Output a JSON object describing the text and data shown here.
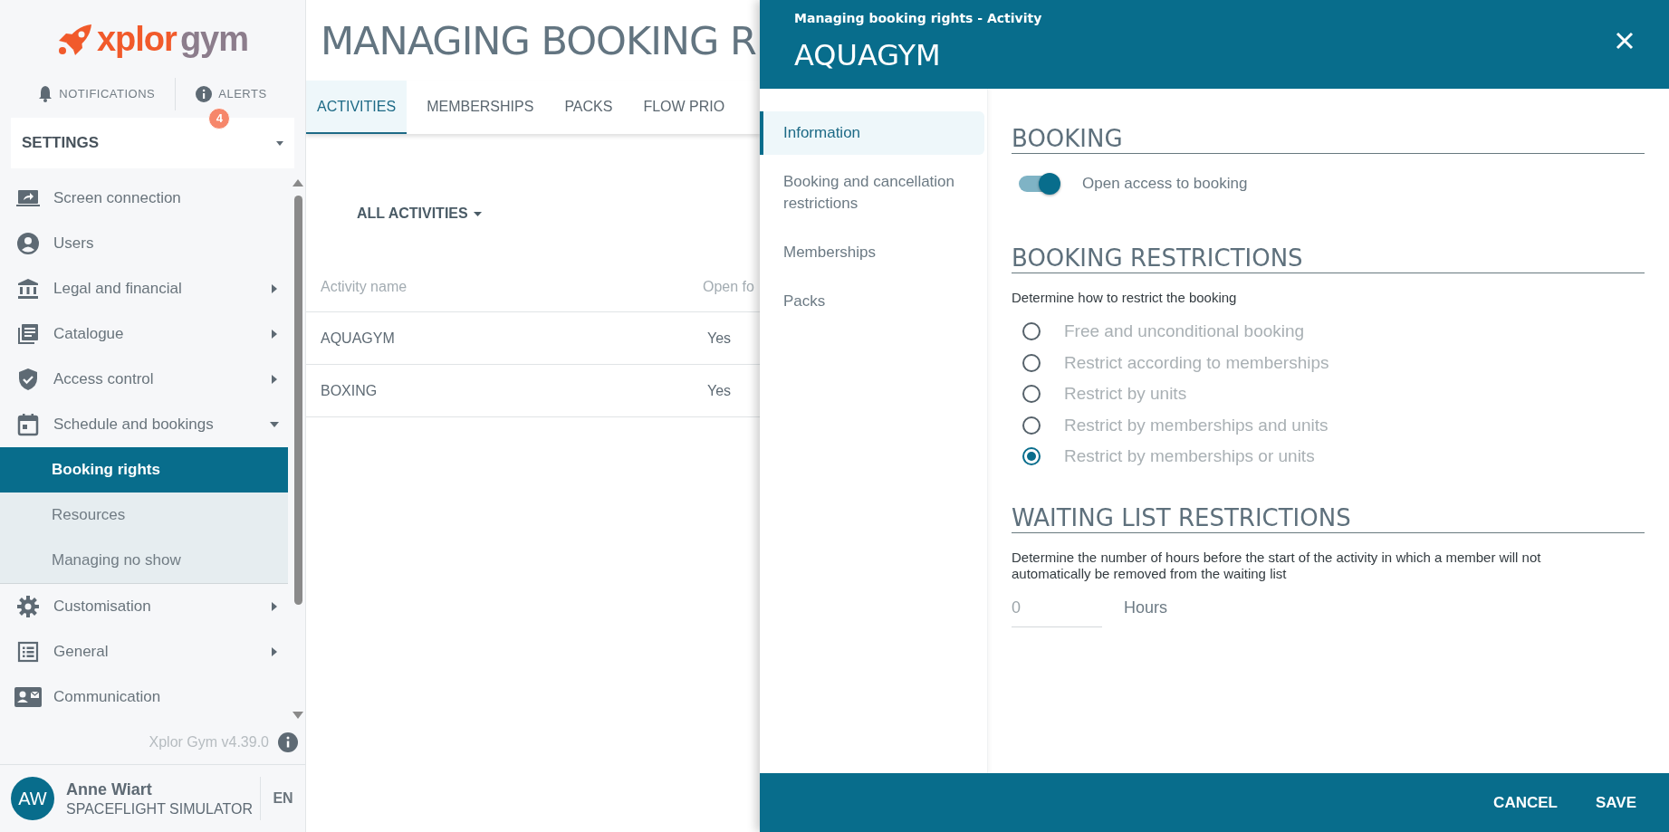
{
  "logo": {
    "brand": "xplor",
    "product": "gym"
  },
  "top_links": [
    {
      "label": "NOTIFICATIONS"
    },
    {
      "label": "ALERTS",
      "badge": "4"
    }
  ],
  "settings_dropdown": {
    "label": "SETTINGS"
  },
  "sidebar": {
    "items": [
      {
        "label": "Screen connection",
        "kind": "link"
      },
      {
        "label": "Users",
        "kind": "link"
      },
      {
        "label": "Legal and financial",
        "kind": "group",
        "expanded": false
      },
      {
        "label": "Catalogue",
        "kind": "group",
        "expanded": false
      },
      {
        "label": "Access control",
        "kind": "group",
        "expanded": false
      },
      {
        "label": "Schedule and bookings",
        "kind": "group",
        "expanded": true,
        "children": [
          {
            "label": "Booking rights",
            "selected": true
          },
          {
            "label": "Resources",
            "selected": false
          },
          {
            "label": "Managing no show",
            "selected": false
          }
        ]
      },
      {
        "label": "Customisation",
        "kind": "group",
        "expanded": false
      },
      {
        "label": "General",
        "kind": "group",
        "expanded": false
      },
      {
        "label": "Communication",
        "kind": "link"
      }
    ]
  },
  "version": "Xplor Gym v4.39.0",
  "user": {
    "initials": "AW",
    "name": "Anne Wiart",
    "company": "SPACEFLIGHT SIMULATOR",
    "language": "EN"
  },
  "main": {
    "title": "MANAGING BOOKING R",
    "tabs": [
      {
        "label": "ACTIVITIES",
        "selected": true
      },
      {
        "label": "MEMBERSHIPS",
        "selected": false
      },
      {
        "label": "PACKS",
        "selected": false
      },
      {
        "label": "FLOW PRIO",
        "selected": false
      }
    ],
    "filter": "ALL ACTIVITIES",
    "table": {
      "columns": [
        "Activity name",
        "Open fo"
      ],
      "rows": [
        [
          "AQUAGYM",
          "Yes"
        ],
        [
          "BOXING",
          "Yes"
        ]
      ]
    }
  },
  "panel": {
    "subtitle": "Managing booking rights - Activity",
    "title": "AQUAGYM",
    "nav": [
      {
        "label": "Information",
        "selected": true
      },
      {
        "label": "Booking and cancellation restrictions",
        "selected": false
      },
      {
        "label": "Memberships",
        "selected": false
      },
      {
        "label": "Packs",
        "selected": false
      }
    ],
    "booking": {
      "heading": "BOOKING",
      "toggle": {
        "label": "Open access to booking",
        "on": true
      }
    },
    "restrictions": {
      "heading": "BOOKING RESTRICTIONS",
      "description": "Determine how to restrict the booking",
      "options": [
        {
          "label": "Free and unconditional booking",
          "selected": false
        },
        {
          "label": "Restrict according to memberships",
          "selected": false
        },
        {
          "label": "Restrict by units",
          "selected": false
        },
        {
          "label": "Restrict by memberships and units",
          "selected": false
        },
        {
          "label": "Restrict by memberships or units",
          "selected": true
        }
      ]
    },
    "waiting_list": {
      "heading": "WAITING LIST RESTRICTIONS",
      "description": "Determine the number of hours before the start of the activity in which a member will not automatically be removed from the waiting list",
      "field": {
        "value": "0",
        "unit": "Hours"
      }
    },
    "buttons": [
      "CANCEL",
      "SAVE"
    ]
  }
}
